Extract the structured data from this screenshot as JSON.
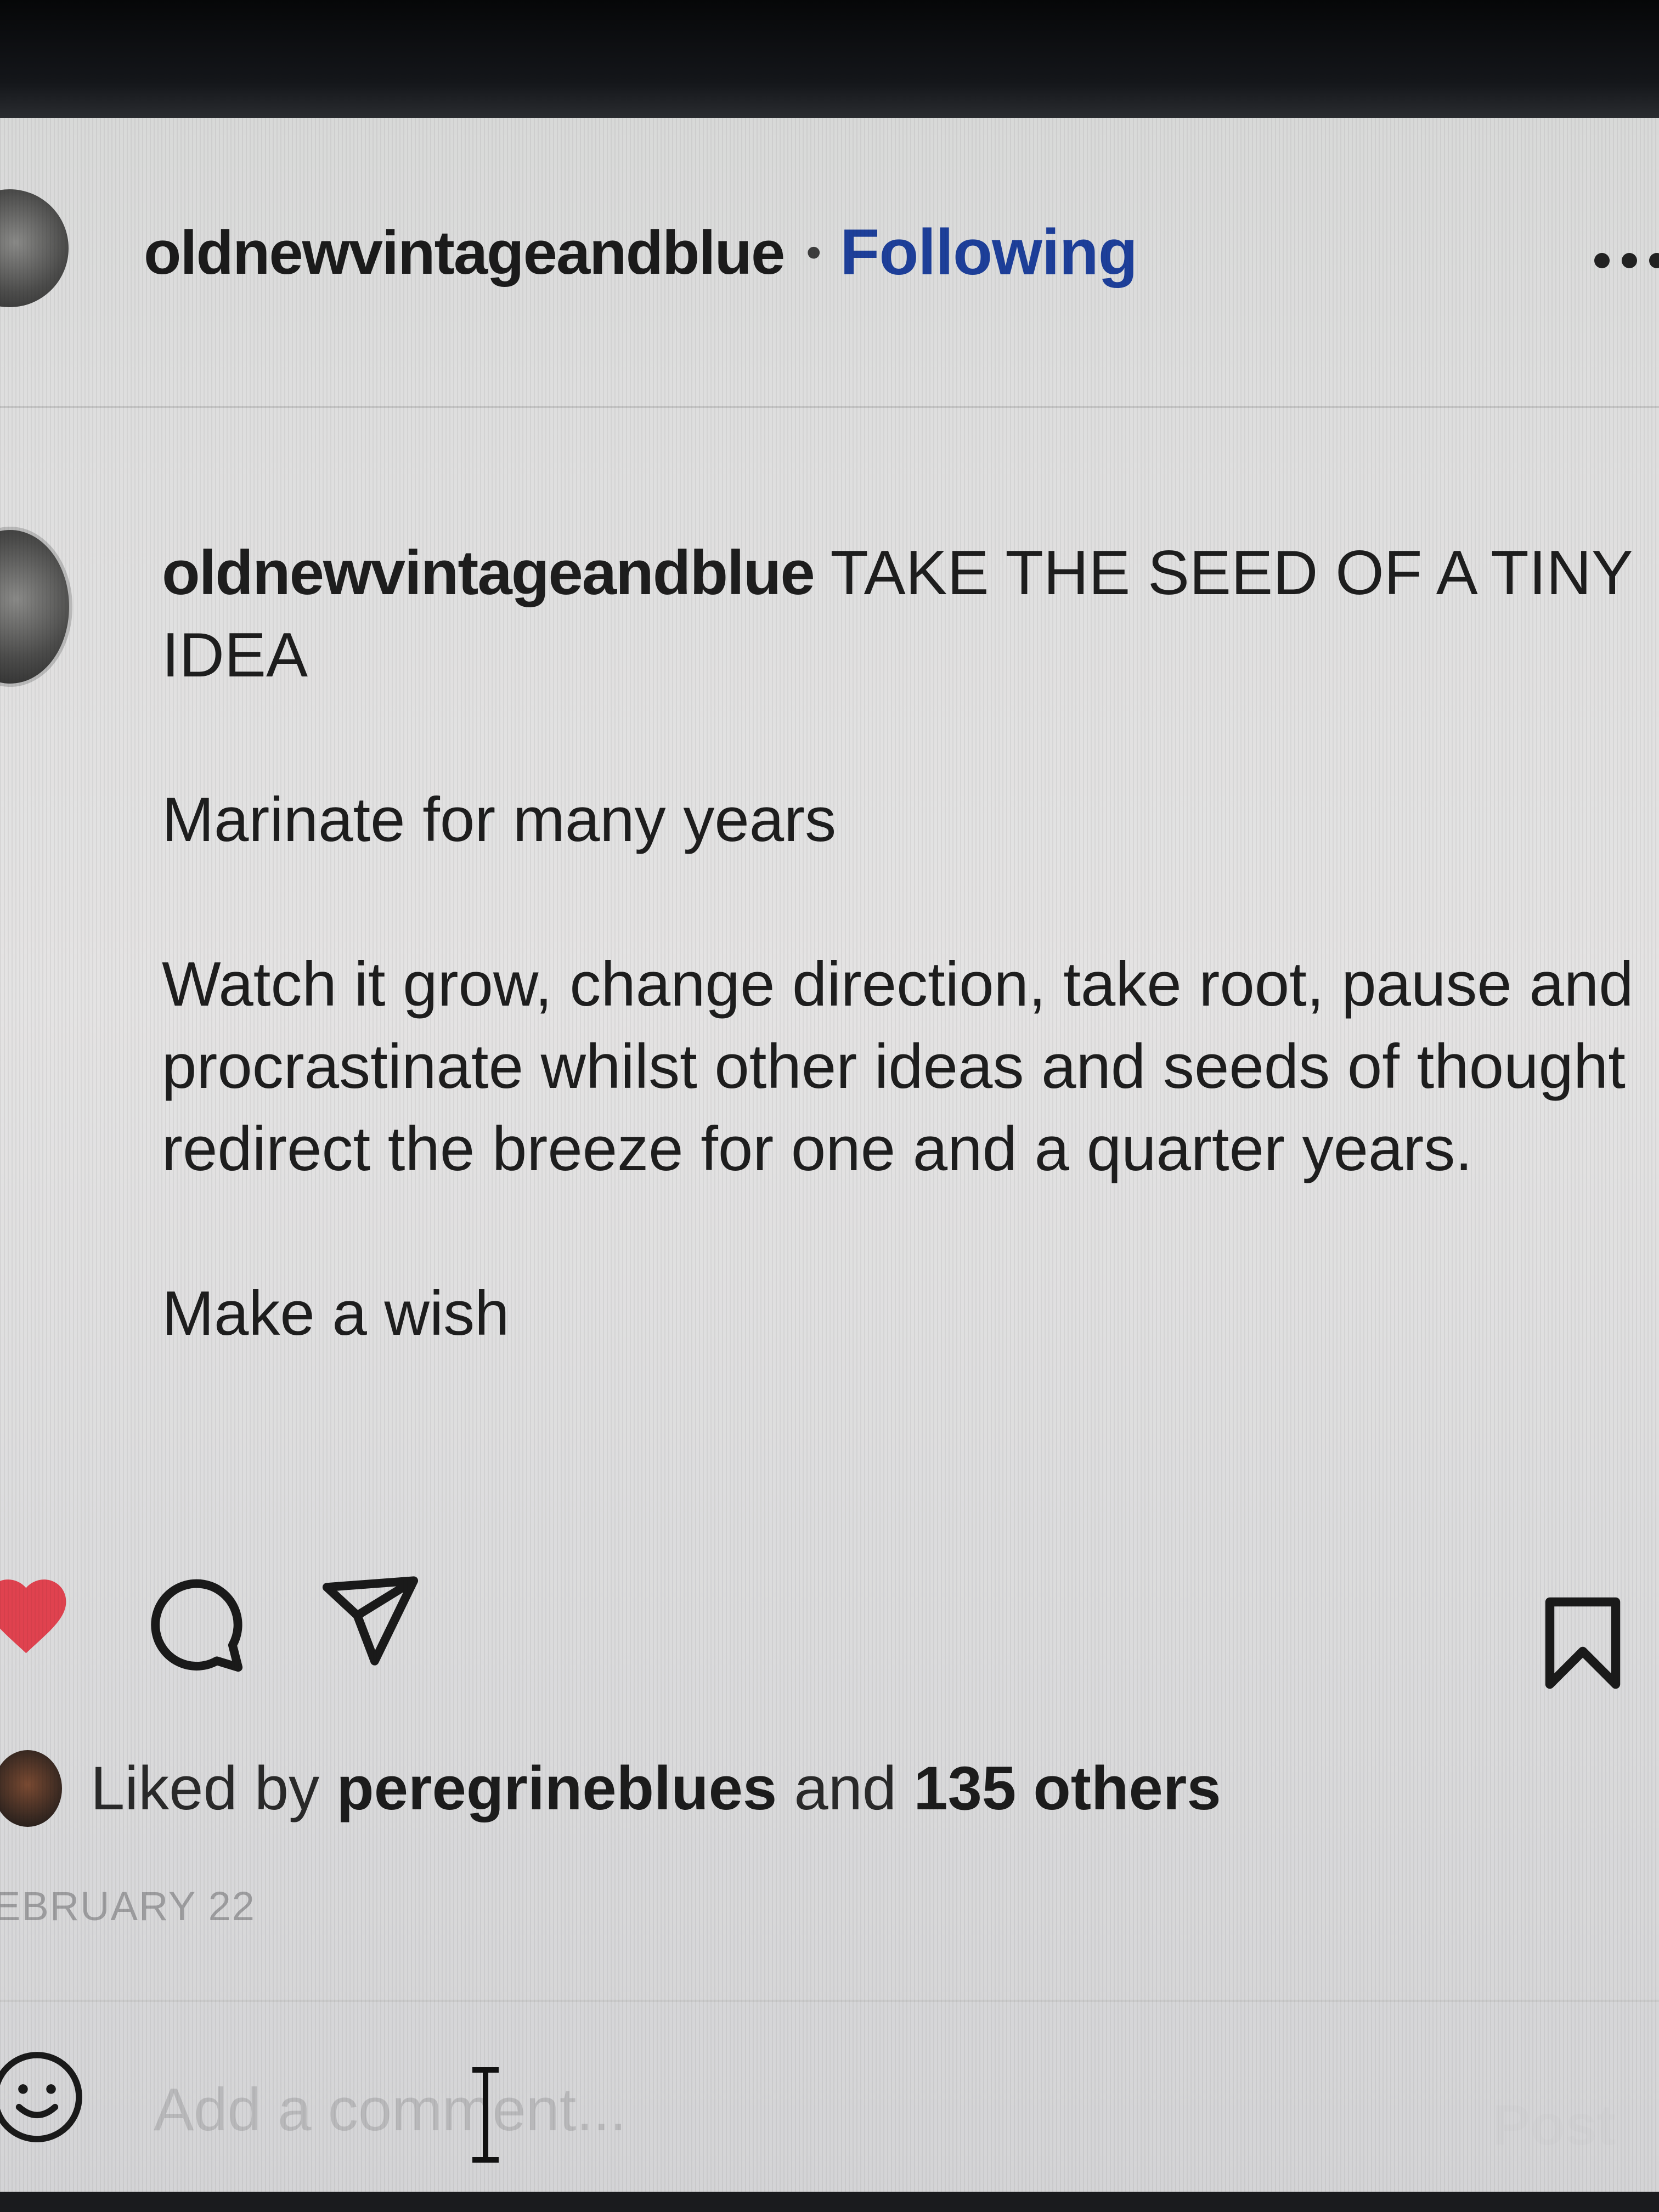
{
  "post_header": {
    "username": "oldnewvintageandblue",
    "separator": "•",
    "follow_status": "Following"
  },
  "caption": {
    "username": "oldnewvintageandblue",
    "title": "TAKE THE SEED OF A TINY IDEA",
    "line2": "Marinate for many years",
    "line3": "Watch it grow, change direction, take root, pause and procrastinate whilst other ideas and seeds of thought redirect the breeze for one and a quarter years.",
    "line4": "Make a wish"
  },
  "actions": {
    "liked": true,
    "like_color": "#e0424f",
    "icons": [
      "heart-icon",
      "comment-icon",
      "share-icon",
      "save-icon"
    ]
  },
  "likes": {
    "prefix": "Liked by",
    "user": "peregrineblues",
    "middle": "and",
    "others": "135 others"
  },
  "date": "EBRUARY 22",
  "comment_box": {
    "placeholder": "Add a comment...",
    "post_label": "Post"
  },
  "colors": {
    "following": "#1d3f9a",
    "text": "#1e1e1e",
    "muted": "#9d9d9f"
  }
}
